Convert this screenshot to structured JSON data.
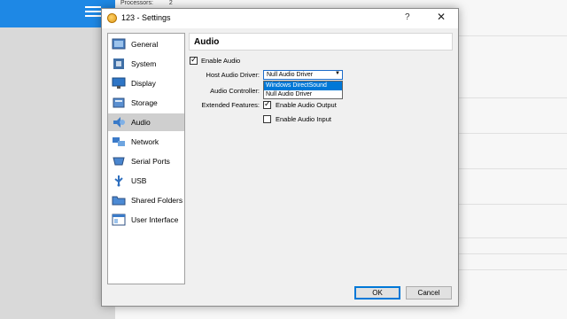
{
  "background": {
    "processors_label": "Processors:",
    "processors_value": "2"
  },
  "dialog": {
    "title": "123 - Settings",
    "help": "?",
    "close": "✕"
  },
  "sidebar": {
    "items": [
      {
        "label": "General",
        "icon": "general-icon"
      },
      {
        "label": "System",
        "icon": "system-icon"
      },
      {
        "label": "Display",
        "icon": "display-icon"
      },
      {
        "label": "Storage",
        "icon": "storage-icon"
      },
      {
        "label": "Audio",
        "icon": "audio-icon",
        "selected": true
      },
      {
        "label": "Network",
        "icon": "network-icon"
      },
      {
        "label": "Serial Ports",
        "icon": "serial-ports-icon"
      },
      {
        "label": "USB",
        "icon": "usb-icon"
      },
      {
        "label": "Shared Folders",
        "icon": "shared-folders-icon"
      },
      {
        "label": "User Interface",
        "icon": "user-interface-icon"
      }
    ]
  },
  "audio": {
    "title": "Audio",
    "enable_audio": "Enable Audio",
    "host_driver_label": "Host Audio Driver:",
    "host_driver_value": "Null Audio Driver",
    "dropdown_options": [
      "Windows DirectSound",
      "Null Audio Driver"
    ],
    "controller_label": "Audio Controller:",
    "extended_label": "Extended Features:",
    "enable_output": "Enable Audio Output",
    "enable_input": "Enable Audio Input"
  },
  "buttons": {
    "ok": "OK",
    "cancel": "Cancel"
  },
  "colors": {
    "accent": "#0078d7",
    "manager_blue": "#1e88e5"
  }
}
